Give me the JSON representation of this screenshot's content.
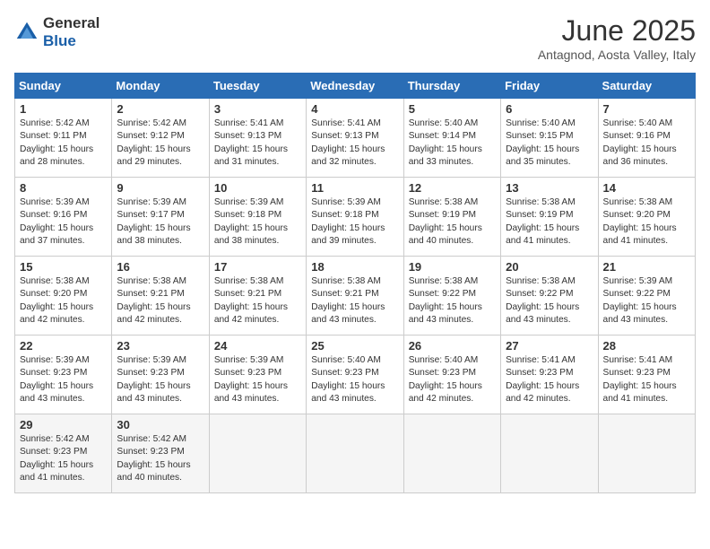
{
  "logo": {
    "text_general": "General",
    "text_blue": "Blue"
  },
  "title": "June 2025",
  "subtitle": "Antagnod, Aosta Valley, Italy",
  "days_of_week": [
    "Sunday",
    "Monday",
    "Tuesday",
    "Wednesday",
    "Thursday",
    "Friday",
    "Saturday"
  ],
  "weeks": [
    [
      {
        "day": "1",
        "lines": [
          "Sunrise: 5:42 AM",
          "Sunset: 9:11 PM",
          "Daylight: 15 hours",
          "and 28 minutes."
        ]
      },
      {
        "day": "2",
        "lines": [
          "Sunrise: 5:42 AM",
          "Sunset: 9:12 PM",
          "Daylight: 15 hours",
          "and 29 minutes."
        ]
      },
      {
        "day": "3",
        "lines": [
          "Sunrise: 5:41 AM",
          "Sunset: 9:13 PM",
          "Daylight: 15 hours",
          "and 31 minutes."
        ]
      },
      {
        "day": "4",
        "lines": [
          "Sunrise: 5:41 AM",
          "Sunset: 9:13 PM",
          "Daylight: 15 hours",
          "and 32 minutes."
        ]
      },
      {
        "day": "5",
        "lines": [
          "Sunrise: 5:40 AM",
          "Sunset: 9:14 PM",
          "Daylight: 15 hours",
          "and 33 minutes."
        ]
      },
      {
        "day": "6",
        "lines": [
          "Sunrise: 5:40 AM",
          "Sunset: 9:15 PM",
          "Daylight: 15 hours",
          "and 35 minutes."
        ]
      },
      {
        "day": "7",
        "lines": [
          "Sunrise: 5:40 AM",
          "Sunset: 9:16 PM",
          "Daylight: 15 hours",
          "and 36 minutes."
        ]
      }
    ],
    [
      {
        "day": "8",
        "lines": [
          "Sunrise: 5:39 AM",
          "Sunset: 9:16 PM",
          "Daylight: 15 hours",
          "and 37 minutes."
        ]
      },
      {
        "day": "9",
        "lines": [
          "Sunrise: 5:39 AM",
          "Sunset: 9:17 PM",
          "Daylight: 15 hours",
          "and 38 minutes."
        ]
      },
      {
        "day": "10",
        "lines": [
          "Sunrise: 5:39 AM",
          "Sunset: 9:18 PM",
          "Daylight: 15 hours",
          "and 38 minutes."
        ]
      },
      {
        "day": "11",
        "lines": [
          "Sunrise: 5:39 AM",
          "Sunset: 9:18 PM",
          "Daylight: 15 hours",
          "and 39 minutes."
        ]
      },
      {
        "day": "12",
        "lines": [
          "Sunrise: 5:38 AM",
          "Sunset: 9:19 PM",
          "Daylight: 15 hours",
          "and 40 minutes."
        ]
      },
      {
        "day": "13",
        "lines": [
          "Sunrise: 5:38 AM",
          "Sunset: 9:19 PM",
          "Daylight: 15 hours",
          "and 41 minutes."
        ]
      },
      {
        "day": "14",
        "lines": [
          "Sunrise: 5:38 AM",
          "Sunset: 9:20 PM",
          "Daylight: 15 hours",
          "and 41 minutes."
        ]
      }
    ],
    [
      {
        "day": "15",
        "lines": [
          "Sunrise: 5:38 AM",
          "Sunset: 9:20 PM",
          "Daylight: 15 hours",
          "and 42 minutes."
        ]
      },
      {
        "day": "16",
        "lines": [
          "Sunrise: 5:38 AM",
          "Sunset: 9:21 PM",
          "Daylight: 15 hours",
          "and 42 minutes."
        ]
      },
      {
        "day": "17",
        "lines": [
          "Sunrise: 5:38 AM",
          "Sunset: 9:21 PM",
          "Daylight: 15 hours",
          "and 42 minutes."
        ]
      },
      {
        "day": "18",
        "lines": [
          "Sunrise: 5:38 AM",
          "Sunset: 9:21 PM",
          "Daylight: 15 hours",
          "and 43 minutes."
        ]
      },
      {
        "day": "19",
        "lines": [
          "Sunrise: 5:38 AM",
          "Sunset: 9:22 PM",
          "Daylight: 15 hours",
          "and 43 minutes."
        ]
      },
      {
        "day": "20",
        "lines": [
          "Sunrise: 5:38 AM",
          "Sunset: 9:22 PM",
          "Daylight: 15 hours",
          "and 43 minutes."
        ]
      },
      {
        "day": "21",
        "lines": [
          "Sunrise: 5:39 AM",
          "Sunset: 9:22 PM",
          "Daylight: 15 hours",
          "and 43 minutes."
        ]
      }
    ],
    [
      {
        "day": "22",
        "lines": [
          "Sunrise: 5:39 AM",
          "Sunset: 9:23 PM",
          "Daylight: 15 hours",
          "and 43 minutes."
        ]
      },
      {
        "day": "23",
        "lines": [
          "Sunrise: 5:39 AM",
          "Sunset: 9:23 PM",
          "Daylight: 15 hours",
          "and 43 minutes."
        ]
      },
      {
        "day": "24",
        "lines": [
          "Sunrise: 5:39 AM",
          "Sunset: 9:23 PM",
          "Daylight: 15 hours",
          "and 43 minutes."
        ]
      },
      {
        "day": "25",
        "lines": [
          "Sunrise: 5:40 AM",
          "Sunset: 9:23 PM",
          "Daylight: 15 hours",
          "and 43 minutes."
        ]
      },
      {
        "day": "26",
        "lines": [
          "Sunrise: 5:40 AM",
          "Sunset: 9:23 PM",
          "Daylight: 15 hours",
          "and 42 minutes."
        ]
      },
      {
        "day": "27",
        "lines": [
          "Sunrise: 5:41 AM",
          "Sunset: 9:23 PM",
          "Daylight: 15 hours",
          "and 42 minutes."
        ]
      },
      {
        "day": "28",
        "lines": [
          "Sunrise: 5:41 AM",
          "Sunset: 9:23 PM",
          "Daylight: 15 hours",
          "and 41 minutes."
        ]
      }
    ],
    [
      {
        "day": "29",
        "lines": [
          "Sunrise: 5:42 AM",
          "Sunset: 9:23 PM",
          "Daylight: 15 hours",
          "and 41 minutes."
        ]
      },
      {
        "day": "30",
        "lines": [
          "Sunrise: 5:42 AM",
          "Sunset: 9:23 PM",
          "Daylight: 15 hours",
          "and 40 minutes."
        ]
      },
      {
        "day": "",
        "lines": []
      },
      {
        "day": "",
        "lines": []
      },
      {
        "day": "",
        "lines": []
      },
      {
        "day": "",
        "lines": []
      },
      {
        "day": "",
        "lines": []
      }
    ]
  ]
}
